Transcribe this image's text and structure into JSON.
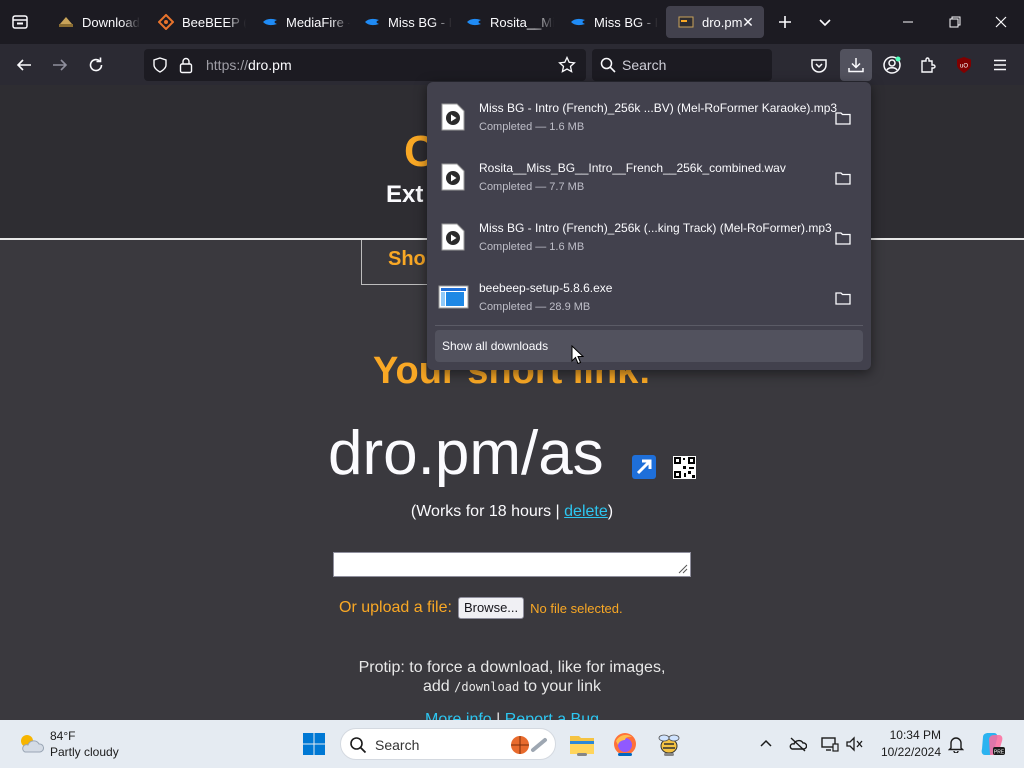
{
  "browser": {
    "tabs": [
      {
        "label": "Download",
        "icon": "hat-icon",
        "active": false
      },
      {
        "label": "BeeBEEP (F",
        "icon": "beebeep-icon",
        "active": false
      },
      {
        "label": "MediaFire -",
        "icon": "mediafire-icon",
        "active": false
      },
      {
        "label": "Miss BG - Ir",
        "icon": "mediafire-icon",
        "active": false
      },
      {
        "label": "Rosita__Mis",
        "icon": "mediafire-icon",
        "active": false
      },
      {
        "label": "Miss BG - Ir",
        "icon": "mediafire-icon",
        "active": false
      },
      {
        "label": "dro.pm",
        "icon": "dropm-icon",
        "active": true
      }
    ],
    "url_scheme": "https://",
    "url_host": "dro.pm",
    "search_placeholder": "Search"
  },
  "downloads": {
    "items": [
      {
        "name": "Miss BG - Intro (French)_256k ...BV) (Mel-RoFormer Karaoke).mp3",
        "status": "Completed — 1.6 MB",
        "icon": "audio-file-icon"
      },
      {
        "name": "Rosita__Miss_BG__Intro__French__256k_combined.wav",
        "status": "Completed — 7.7 MB",
        "icon": "audio-file-icon"
      },
      {
        "name": "Miss BG - Intro (French)_256k (...king Track) (Mel-RoFormer).mp3",
        "status": "Completed — 1.6 MB",
        "icon": "audio-file-icon"
      },
      {
        "name": "beebeep-setup-5.8.6.exe",
        "status": "Completed — 28.9 MB",
        "icon": "exe-file-icon"
      }
    ],
    "show_all_label": "Show all downloads"
  },
  "page": {
    "logo_letter": "C",
    "header_text": "Ext",
    "short_tab_label": "Shor",
    "your_link_heading": "Your short link:",
    "short_url": "dro.pm/as",
    "works_prefix": "(Works for 18 hours | ",
    "delete_label": "delete",
    "works_suffix": ")",
    "upload_label": "Or upload a file:",
    "browse_label": "Browse...",
    "no_file_label": "No file selected.",
    "protip_line1": "Protip: to force a download, like for images,",
    "protip_add": "add ",
    "protip_code": "/download",
    "protip_end": " to your link",
    "more_info_label": "More info",
    "link_separator": " | ",
    "report_bug_label": "Report a Bug"
  },
  "taskbar": {
    "weather_temp": "84°F",
    "weather_desc": "Partly cloudy",
    "search_label": "Search",
    "clock_time": "10:34 PM",
    "clock_date": "10/22/2024"
  },
  "colors": {
    "accent_orange": "#f9a825",
    "link_blue": "#2dc6f0",
    "browser_dark": "#1c1b22",
    "panel_bg": "#42414d",
    "taskbar_bg": "#e5ebf2"
  }
}
